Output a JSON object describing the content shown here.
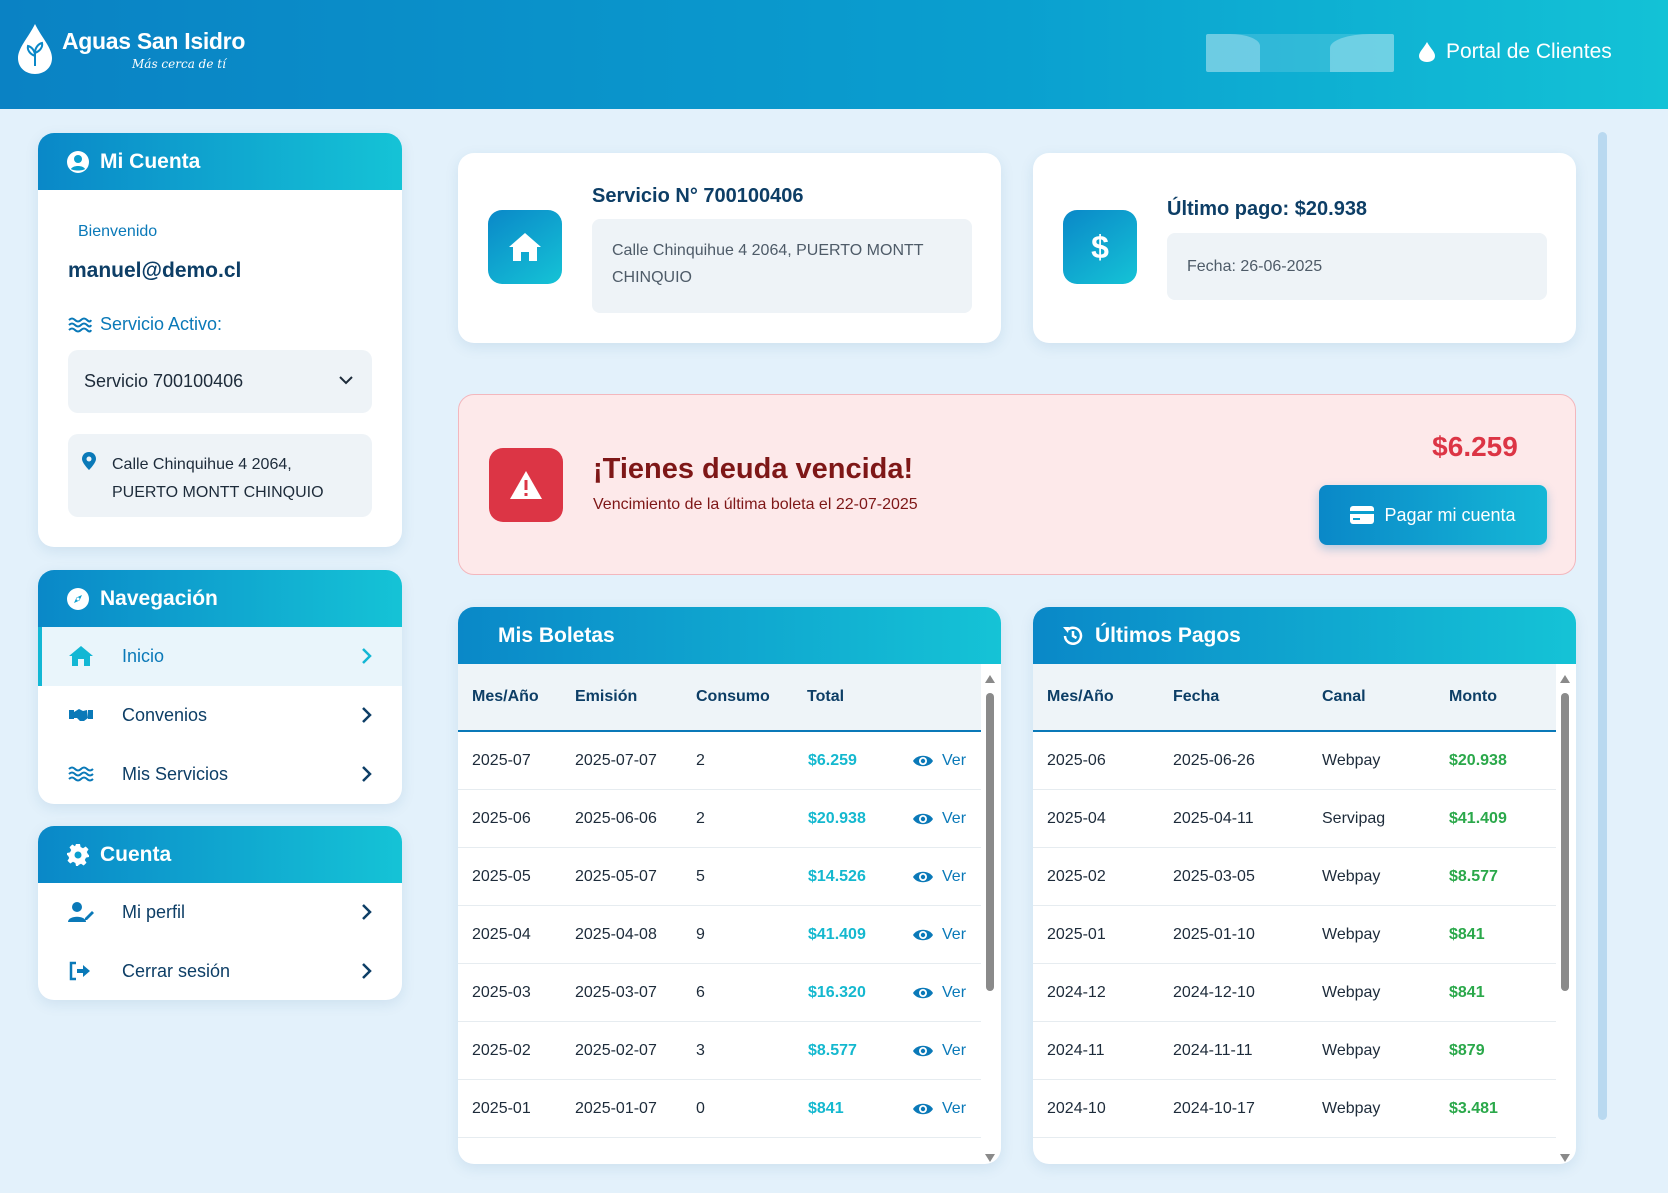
{
  "header": {
    "brand_name": "Aguas San Isidro",
    "tagline": "Más cerca de tí",
    "portal_label": "Portal de Clientes"
  },
  "account": {
    "title": "Mi Cuenta",
    "welcome": "Bienvenido",
    "email": "manuel@demo.cl",
    "active_service_label": "Servicio Activo:",
    "selected_service": "Servicio 700100406",
    "address_line1": "Calle Chinquihue 4 2064,",
    "address_line2": "PUERTO MONTT CHINQUIO"
  },
  "navigation": {
    "title": "Navegación",
    "items": [
      {
        "label": "Inicio",
        "icon": "home-icon",
        "active": true
      },
      {
        "label": "Convenios",
        "icon": "handshake-icon",
        "active": false
      },
      {
        "label": "Mis Servicios",
        "icon": "water-icon",
        "active": false
      }
    ]
  },
  "cuenta": {
    "title": "Cuenta",
    "items": [
      {
        "label": "Mi perfil",
        "icon": "user-edit-icon"
      },
      {
        "label": "Cerrar sesión",
        "icon": "logout-icon"
      }
    ]
  },
  "service_card": {
    "title": "Servicio N° 700100406",
    "address_line1": "Calle Chinquihue 4 2064, PUERTO MONTT",
    "address_line2": "CHINQUIO"
  },
  "payment_card": {
    "title": "Último pago: $20.938",
    "date": "Fecha: 26-06-2025"
  },
  "debt": {
    "title": "¡Tienes deuda vencida!",
    "subtitle": "Vencimiento de la última boleta el 22-07-2025",
    "amount": "$6.259",
    "pay_button": "Pagar mi cuenta"
  },
  "boletas": {
    "title": "Mis Boletas",
    "columns": [
      "Mes/Año",
      "Emisión",
      "Consumo",
      "Total"
    ],
    "view_label": "Ver",
    "rows": [
      [
        "2025-07",
        "2025-07-07",
        "2",
        "$6.259"
      ],
      [
        "2025-06",
        "2025-06-06",
        "2",
        "$20.938"
      ],
      [
        "2025-05",
        "2025-05-07",
        "5",
        "$14.526"
      ],
      [
        "2025-04",
        "2025-04-08",
        "9",
        "$41.409"
      ],
      [
        "2025-03",
        "2025-03-07",
        "6",
        "$16.320"
      ],
      [
        "2025-02",
        "2025-02-07",
        "3",
        "$8.577"
      ],
      [
        "2025-01",
        "2025-01-07",
        "0",
        "$841"
      ]
    ]
  },
  "pagos": {
    "title": "Últimos Pagos",
    "columns": [
      "Mes/Año",
      "Fecha",
      "Canal",
      "Monto"
    ],
    "rows": [
      [
        "2025-06",
        "2025-06-26",
        "Webpay",
        "$20.938"
      ],
      [
        "2025-04",
        "2025-04-11",
        "Servipag",
        "$41.409"
      ],
      [
        "2025-02",
        "2025-03-05",
        "Webpay",
        "$8.577"
      ],
      [
        "2025-01",
        "2025-01-10",
        "Webpay",
        "$841"
      ],
      [
        "2024-12",
        "2024-12-10",
        "Webpay",
        "$841"
      ],
      [
        "2024-11",
        "2024-11-11",
        "Webpay",
        "$879"
      ],
      [
        "2024-10",
        "2024-10-17",
        "Webpay",
        "$3.481"
      ]
    ]
  },
  "colors": {
    "primary": "#0a88c8",
    "accent": "#15c3d6",
    "danger": "#dc3545",
    "success": "#2aa84a"
  }
}
